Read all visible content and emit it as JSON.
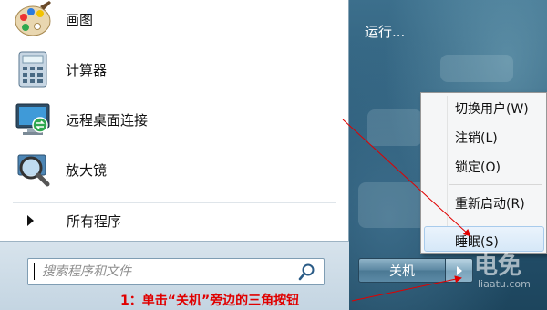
{
  "programs": [
    {
      "label": "画图",
      "icon": "paint-icon"
    },
    {
      "label": "计算器",
      "icon": "calculator-icon"
    },
    {
      "label": "远程桌面连接",
      "icon": "remote-desktop-icon"
    },
    {
      "label": "放大镜",
      "icon": "magnifier-icon"
    }
  ],
  "all_programs": {
    "label": "所有程序",
    "icon": "triangle-right-icon"
  },
  "search": {
    "placeholder": "搜索程序和文件",
    "icon": "search-icon"
  },
  "right_panel": {
    "run_label": "运行..."
  },
  "shutdown": {
    "label": "关机",
    "arrow_icon": "triangle-right-icon"
  },
  "context_menu": {
    "items": [
      {
        "label": "切换用户(W)"
      },
      {
        "label": "注销(L)"
      },
      {
        "label": "锁定(O)"
      },
      {
        "label": "重新启动(R)"
      },
      {
        "label": "睡眠(S)",
        "highlighted": true
      }
    ]
  },
  "annotation": {
    "text": "1：单击“关机”旁边的三角按钮",
    "color": "#e00000"
  },
  "watermark": {
    "text": "电免",
    "sub": "liaatu.com"
  }
}
